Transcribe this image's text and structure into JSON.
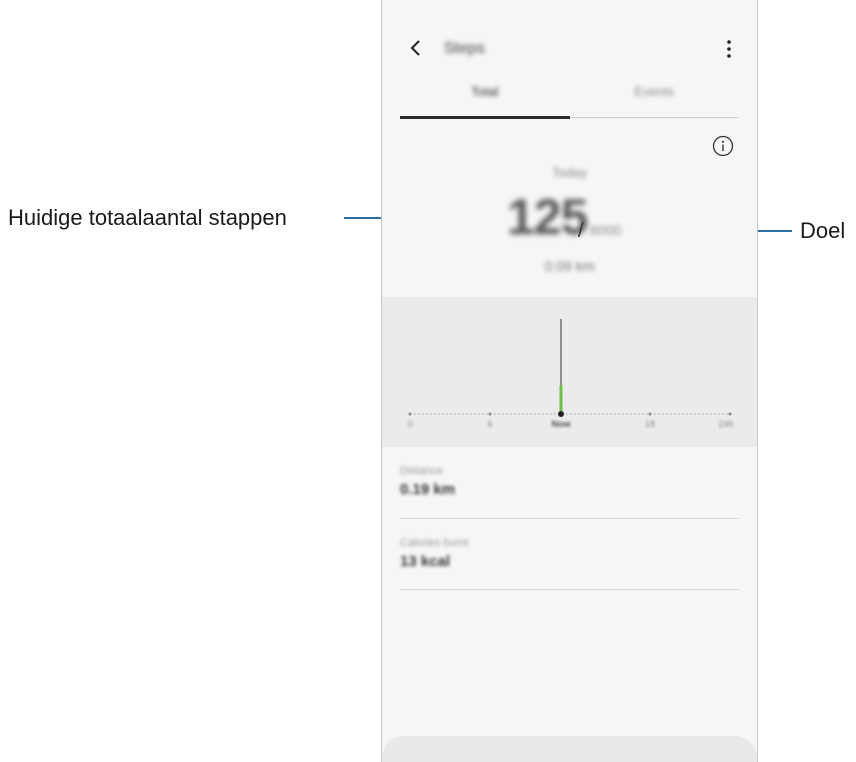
{
  "callouts": {
    "left_label": "Huidige totaalaantal stappen",
    "right_label": "Doel",
    "line_color": "#2b6fa8"
  },
  "app": {
    "title": "Steps",
    "tabs": [
      {
        "label": "Total",
        "active": true
      },
      {
        "label": "Events",
        "active": false
      }
    ],
    "date": "Today",
    "steps_current": "125",
    "separator": "/",
    "steps_goal": "6000",
    "distance_summary": "0.09 km",
    "chart": {
      "x_ticks": [
        "0",
        "6",
        "Now",
        "18",
        "24h"
      ],
      "accent_color": "#6cc04a"
    },
    "stats": [
      {
        "label": "Distance",
        "value": "0.19 km"
      },
      {
        "label": "Calories burnt",
        "value": "13 kcal"
      }
    ]
  }
}
